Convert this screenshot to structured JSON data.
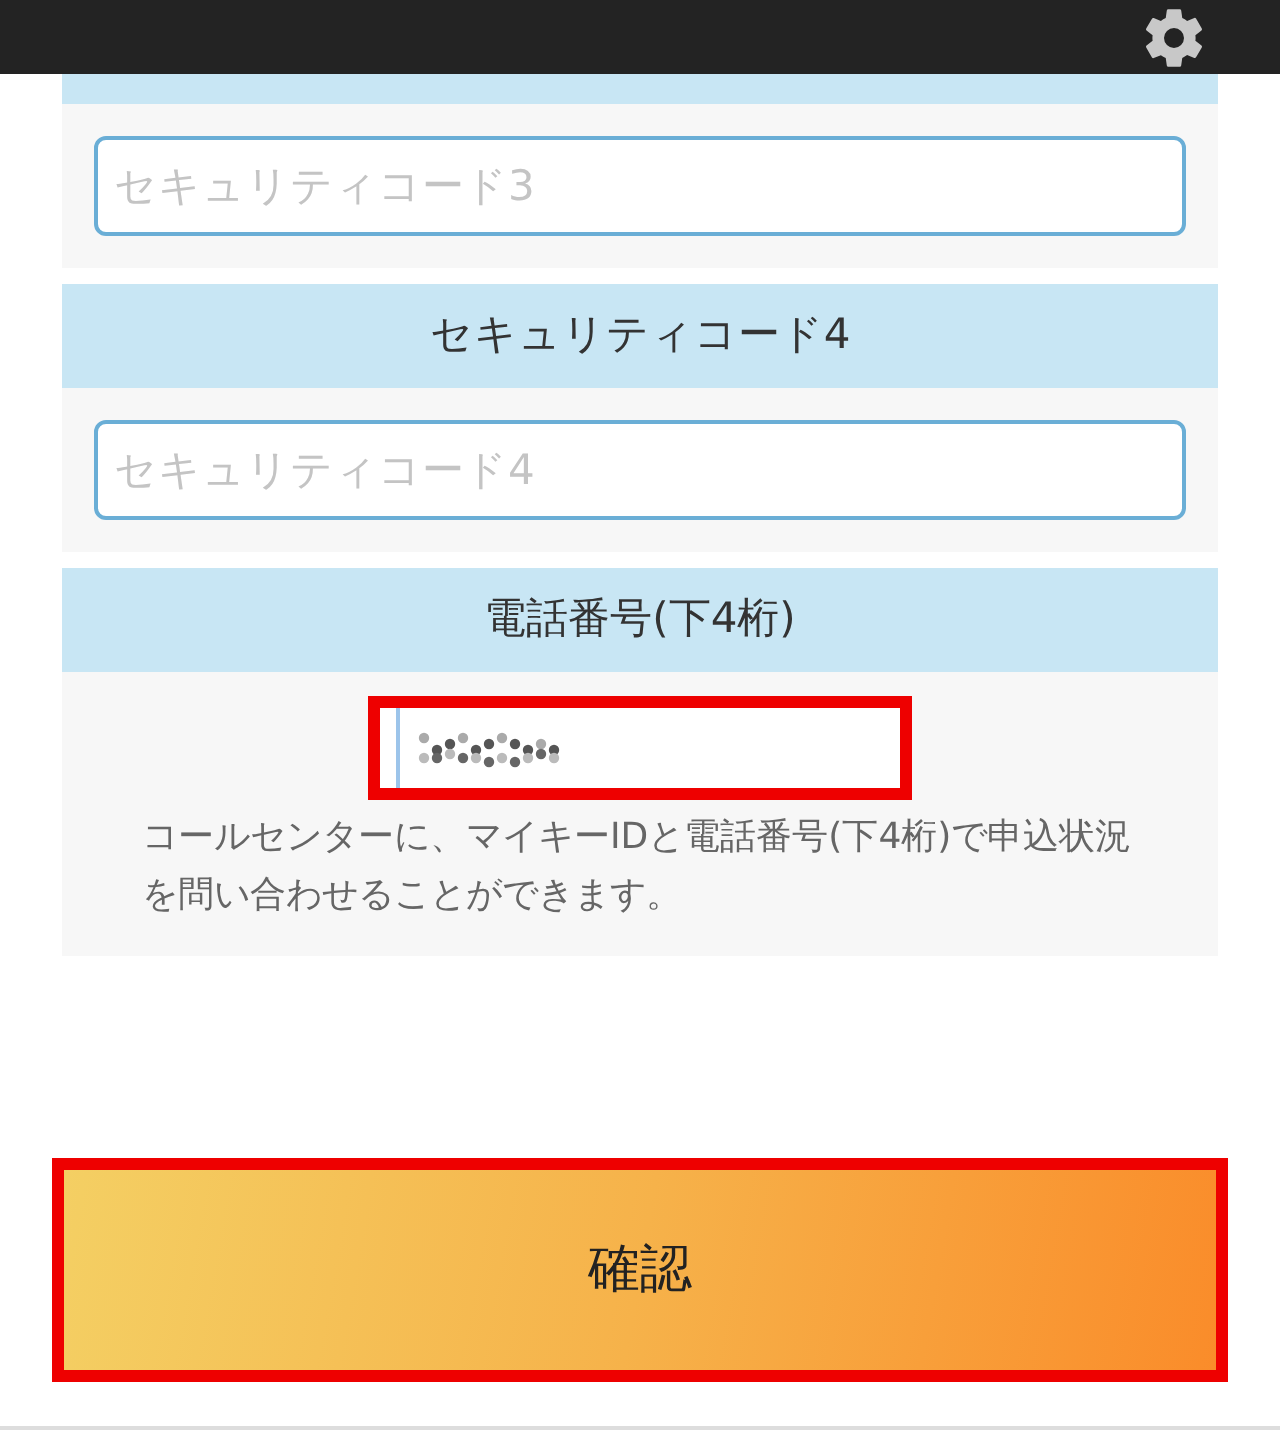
{
  "sections": [
    {
      "kind": "text",
      "placeholder": "セキュリティコード3"
    },
    {
      "kind": "text",
      "header": "セキュリティコード4",
      "placeholder": "セキュリティコード4"
    },
    {
      "kind": "phone",
      "header": "電話番号(下4桁)",
      "highlighted": true,
      "note": "コールセンターに、マイキーIDと電話番号(下4桁)で申込状況を問い合わせることができます。"
    }
  ],
  "confirm_button": {
    "label": "確認",
    "highlighted": true
  }
}
